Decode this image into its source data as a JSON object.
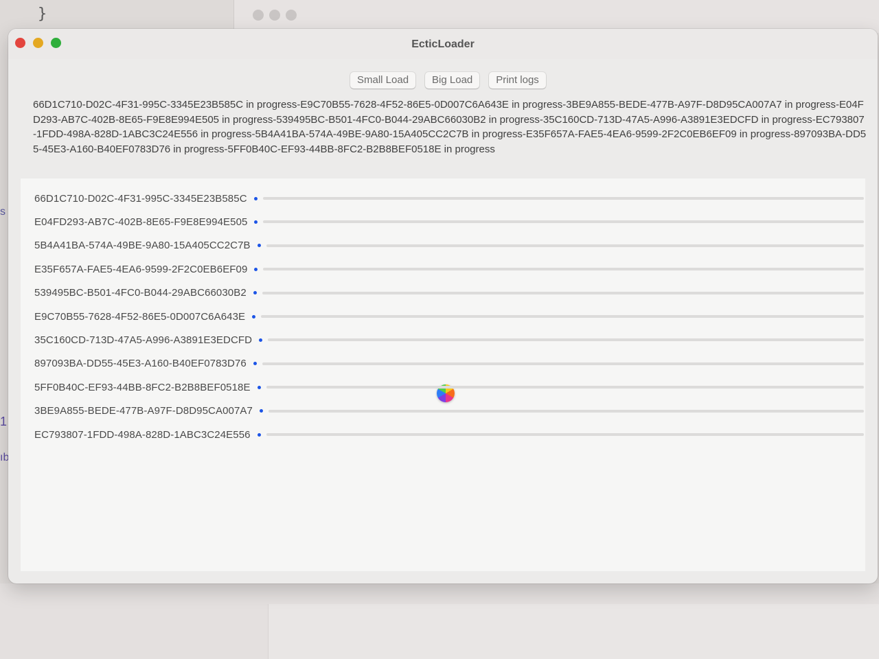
{
  "background": {
    "code_brace": "}",
    "edge_chars": [
      "s",
      "1",
      "ıb"
    ]
  },
  "window": {
    "title": "EcticLoader"
  },
  "toolbar": {
    "small_load_label": "Small Load",
    "big_load_label": "Big Load",
    "print_logs_label": "Print logs"
  },
  "log": {
    "text": "66D1C710-D02C-4F31-995C-3345E23B585C in progress-E9C70B55-7628-4F52-86E5-0D007C6A643E in progress-3BE9A855-BEDE-477B-A97F-D8D95CA007A7 in progress-E04FD293-AB7C-402B-8E65-F9E8E994E505 in progress-539495BC-B501-4FC0-B044-29ABC66030B2 in progress-35C160CD-713D-47A5-A996-A3891E3EDCFD in progress-EC793807-1FDD-498A-828D-1ABC3C24E556 in progress-5B4A41BA-574A-49BE-9A80-15A405CC2C7B in progress-E35F657A-FAE5-4EA6-9599-2F2C0EB6EF09 in progress-897093BA-DD55-45E3-A160-B40EF0783D76 in progress-5FF0B40C-EF93-44BB-8FC2-B2B8BEF0518E in progress"
  },
  "items": [
    {
      "id": "66D1C710-D02C-4F31-995C-3345E23B585C",
      "progress": 0.0
    },
    {
      "id": "E04FD293-AB7C-402B-8E65-F9E8E994E505",
      "progress": 0.0
    },
    {
      "id": "5B4A41BA-574A-49BE-9A80-15A405CC2C7B",
      "progress": 0.0
    },
    {
      "id": "E35F657A-FAE5-4EA6-9599-2F2C0EB6EF09",
      "progress": 0.0
    },
    {
      "id": "539495BC-B501-4FC0-B044-29ABC66030B2",
      "progress": 0.0
    },
    {
      "id": "E9C70B55-7628-4F52-86E5-0D007C6A643E",
      "progress": 0.0
    },
    {
      "id": "35C160CD-713D-47A5-A996-A3891E3EDCFD",
      "progress": 0.0
    },
    {
      "id": "897093BA-DD55-45E3-A160-B40EF0783D76",
      "progress": 0.0
    },
    {
      "id": "5FF0B40C-EF93-44BB-8FC2-B2B8BEF0518E",
      "progress": 0.0
    },
    {
      "id": "3BE9A855-BEDE-477B-A97F-D8D95CA007A7",
      "progress": 0.0
    },
    {
      "id": "EC793807-1FDD-498A-828D-1ABC3C24E556",
      "progress": 0.0
    }
  ],
  "colors": {
    "progress_dot": "#1c54e6",
    "close": "#e3453e",
    "minimize": "#e4a822",
    "zoom": "#2fae3b"
  }
}
